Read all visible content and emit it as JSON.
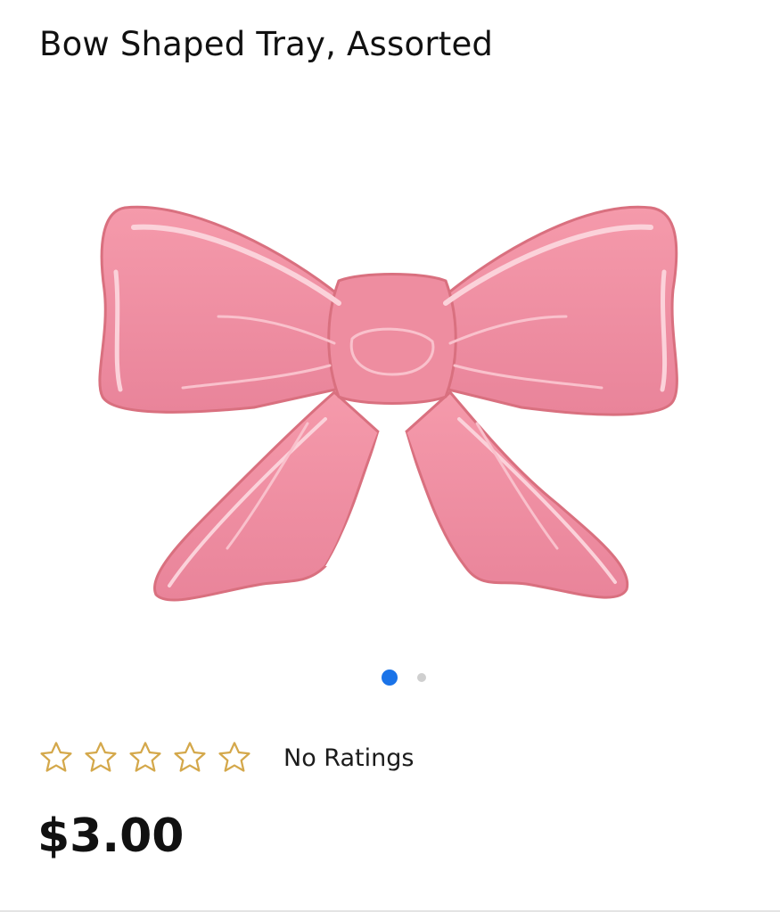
{
  "product": {
    "title": "Bow Shaped Tray, Assorted",
    "image_icon": "pink-bow-tray-image",
    "price": "$3.00",
    "currency_color": "#111111"
  },
  "carousel": {
    "total_slides": 2,
    "active_slide": 1,
    "active_color": "#1a73e8",
    "inactive_color": "#cfcfcf"
  },
  "rating": {
    "stars_total": 5,
    "stars_filled": 0,
    "star_icon": "star-outline-icon",
    "star_color": "#d4a84b",
    "label": "No Ratings"
  },
  "colors": {
    "bow_pink": "#f08fa1",
    "bow_pink_dark": "#db7689",
    "bow_highlight": "#fbd2da"
  }
}
